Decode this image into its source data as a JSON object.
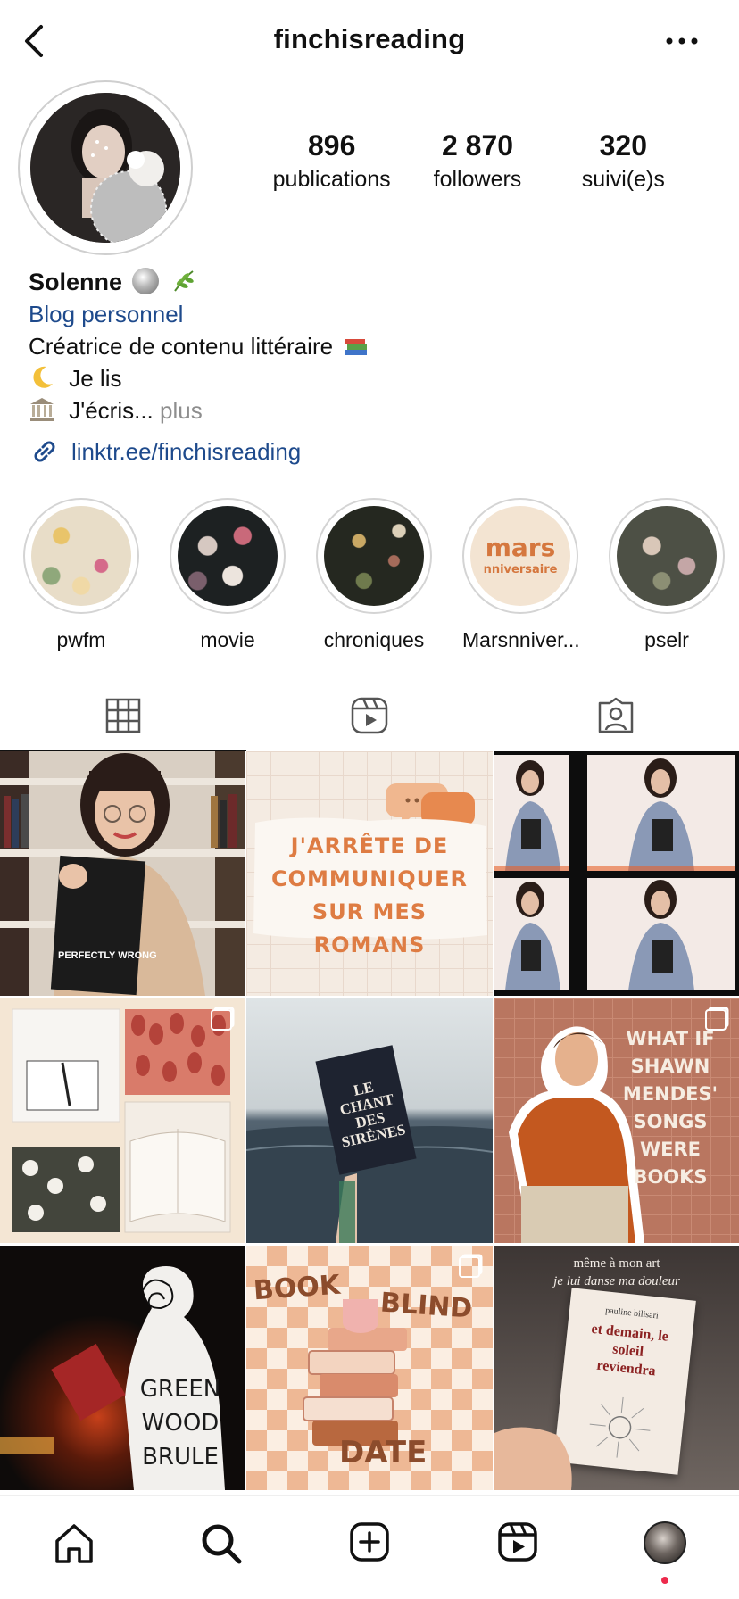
{
  "header": {
    "username": "finchisreading",
    "back_icon": "chevron-left-icon",
    "more_icon": "more-horizontal-icon"
  },
  "profile": {
    "stats": [
      {
        "value": "896",
        "label": "publications"
      },
      {
        "value": "2 870",
        "label": "followers"
      },
      {
        "value": "320",
        "label": "suivi(e)s"
      }
    ]
  },
  "bio": {
    "name": "Solenne",
    "category": "Blog personnel",
    "line1": "Créatrice de contenu littéraire",
    "line2": "Je lis",
    "line3": "J'écris...",
    "more": "plus",
    "link": "linktr.ee/finchisreading"
  },
  "highlights": [
    {
      "label": "pwfm"
    },
    {
      "label": "movie"
    },
    {
      "label": "chroniques"
    },
    {
      "label": "Marsnniver...",
      "badge_text_top": "mars",
      "badge_text_bottom": "nniversaire"
    },
    {
      "label": "pselr"
    }
  ],
  "tabs": [
    {
      "name": "grid",
      "icon": "grid-icon"
    },
    {
      "name": "reels",
      "icon": "reels-icon"
    },
    {
      "name": "tagged",
      "icon": "tagged-user-icon"
    }
  ],
  "posts": {
    "p1_book": "PERFECTLY WRONG",
    "p2_text": "J'ARRÊTE DE COMMUNIQUER SUR MES ROMANS",
    "p5_book_line1": "LE",
    "p5_book_line2": "CHANT",
    "p5_book_line3": "DES",
    "p5_book_line4": "SIRÈNES",
    "p6_text": "WHAT IF SHAWN MENDES' SONGS WERE BOOKS",
    "p7_text": "GREEN WOOD BRULE",
    "p8_text_top": "BOOK",
    "p8_text_right": "BLIND",
    "p8_text_bottom": "DATE",
    "p9_quote_line1": "même à mon art",
    "p9_quote_line2": "je lui danse ma douleur",
    "p9_author": "pauline bilisari",
    "p9_title": "et demain, le soleil reviendra"
  },
  "nav": [
    {
      "name": "home",
      "icon": "home-icon"
    },
    {
      "name": "search",
      "icon": "search-icon"
    },
    {
      "name": "create",
      "icon": "add-post-icon"
    },
    {
      "name": "reels",
      "icon": "reels-icon"
    },
    {
      "name": "profile",
      "icon": "profile-avatar"
    }
  ],
  "colors": {
    "link": "#1e4a8c",
    "notification_dot": "#ed2a4c",
    "muted": "#8e8e8e"
  }
}
